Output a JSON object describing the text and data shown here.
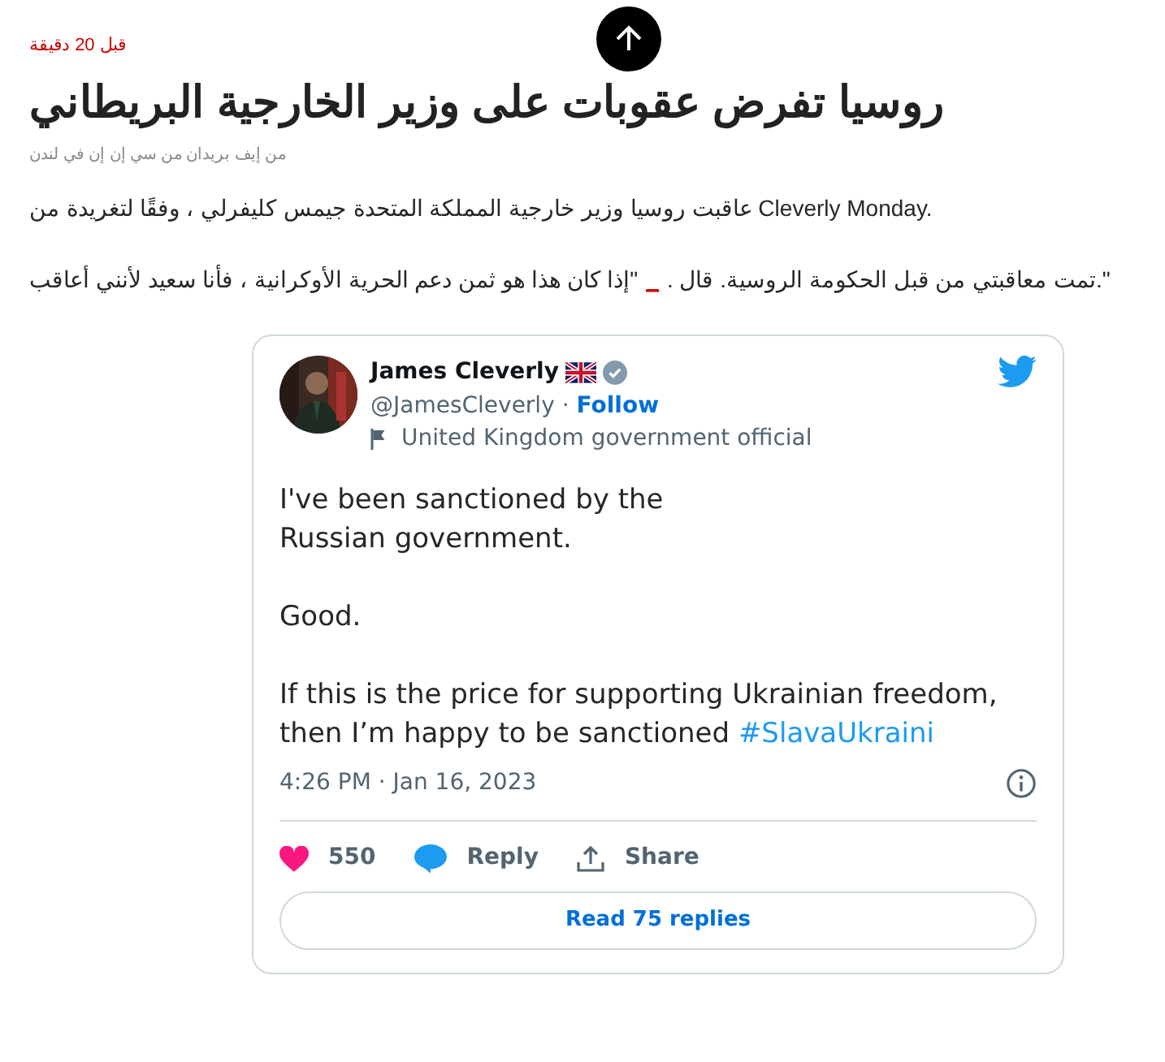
{
  "article": {
    "time": "قبل 20 دقيقة",
    "title": "روسيا تفرض عقوبات على وزير الخارجية البريطاني",
    "byline": "من إيف بريدان من سي إن إن في لندن",
    "paragraphs": [
      {
        "parts": [
          {
            "kind": "text",
            "text": "عاقبت روسيا وزير خارجية المملكة المتحدة جيمس كليفرلي ، وفقًا لتغريدة من Cleverly Monday."
          }
        ]
      },
      {
        "parts": [
          {
            "kind": "rtl",
            "text": "\".تمت معاقبتي من قبل الحكومة الروسية. قال ."
          },
          {
            "kind": "link",
            "text": "_"
          },
          {
            "kind": "rtl",
            "text": "\"إذا كان هذا هو ثمن دعم الحرية الأوكرانية ، فأنا سعيد لأنني أعاقب"
          }
        ]
      }
    ]
  },
  "tweet": {
    "name": "James Cleverly",
    "handle": "@JamesCleverly",
    "separator": "·",
    "follow": "Follow",
    "label": "United Kingdom government official",
    "lines": [
      {
        "kind": "text",
        "parts": [
          {
            "kind": "text",
            "text": "I've been sanctioned by the"
          }
        ]
      },
      {
        "kind": "text",
        "parts": [
          {
            "kind": "text",
            "text": "Russian government."
          }
        ]
      },
      {
        "kind": "blank"
      },
      {
        "kind": "text",
        "parts": [
          {
            "kind": "text",
            "text": "Good."
          }
        ]
      },
      {
        "kind": "blank"
      },
      {
        "kind": "text",
        "parts": [
          {
            "kind": "text",
            "text": "If this is the price for supporting Ukrainian freedom,"
          }
        ]
      },
      {
        "kind": "text",
        "parts": [
          {
            "kind": "text",
            "text": "then I’m happy to be sanctioned "
          },
          {
            "kind": "hashtag",
            "text": "#SlavaUkraini"
          }
        ]
      }
    ],
    "timestamp": "4:26 PM · Jan 16, 2023",
    "likes": "550",
    "reply": "Reply",
    "share": "Share",
    "read_replies": "Read 75 replies"
  }
}
